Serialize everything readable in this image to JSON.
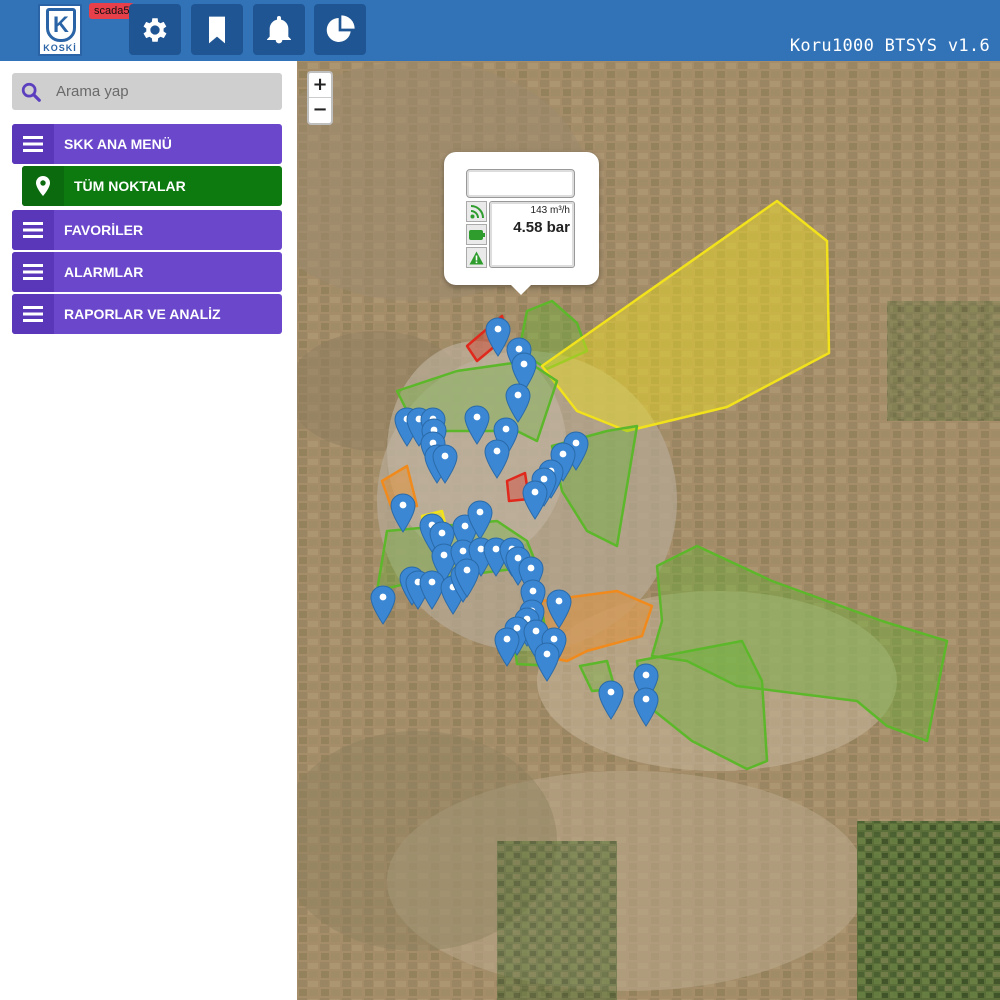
{
  "app": {
    "logo_text": "KOSKİ",
    "logo_letter": "K",
    "env_badge": "scada5",
    "title": "Koru1000 BTSYS v1.6",
    "toolbar": [
      {
        "name": "settings-button",
        "icon": "gear-icon"
      },
      {
        "name": "bookmark-button",
        "icon": "bookmark-icon"
      },
      {
        "name": "notifications-button",
        "icon": "bell-icon"
      },
      {
        "name": "reports-chart-button",
        "icon": "pie-chart-icon"
      }
    ]
  },
  "sidebar": {
    "search": {
      "placeholder": "Arama yap",
      "value": ""
    },
    "items": [
      {
        "label": "SKK ANA MENÜ",
        "icon": "hamburger-icon",
        "color": "#6a47cb"
      },
      {
        "label": "TÜM NOKTALAR",
        "icon": "map-marker-icon",
        "color": "#0d7a10"
      },
      {
        "label": "FAVORİLER",
        "icon": "hamburger-icon",
        "color": "#6a47cb"
      },
      {
        "label": "ALARMLAR",
        "icon": "hamburger-icon",
        "color": "#6a47cb"
      },
      {
        "label": "RAPORLAR VE ANALİZ",
        "icon": "hamburger-icon",
        "color": "#6a47cb"
      }
    ]
  },
  "map": {
    "zoom_in": "+",
    "zoom_out": "−",
    "popup": {
      "name": "",
      "flow": "143 m³/h",
      "pressure": "4.58 bar",
      "status_icons": [
        "signal-icon",
        "battery-icon",
        "warning-icon"
      ]
    },
    "zone_colors": {
      "green": "#5cb82a",
      "yellow": "#f2e21c",
      "orange": "#f08a1c",
      "red": "#e0281c"
    },
    "marker_color": "#3b87d4"
  }
}
